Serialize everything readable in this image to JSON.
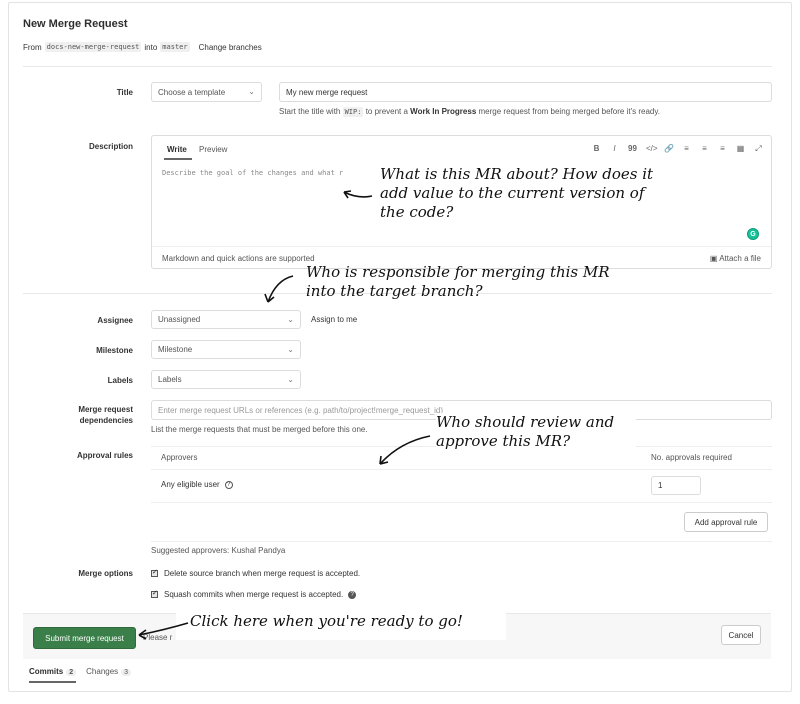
{
  "header": {
    "title": "New Merge Request",
    "from_label": "From",
    "source_branch": "docs-new-merge-request",
    "into_label": "into",
    "target_branch": "master",
    "change_branches": "Change branches"
  },
  "title_field": {
    "label": "Title",
    "template_dropdown": "Choose a template",
    "value": "My new merge request",
    "help_prefix": "Start the title with",
    "help_code": "WIP:",
    "help_middle": "to prevent a",
    "help_bold": "Work In Progress",
    "help_suffix": "merge request from being merged before it's ready."
  },
  "description": {
    "label": "Description",
    "tab_write": "Write",
    "tab_preview": "Preview",
    "toolbar": [
      "B",
      "I",
      "99",
      "</>",
      "🔗",
      "≡",
      "≡",
      "≡",
      "▦",
      "⤢"
    ],
    "placeholder": "Describe the goal of the changes and what r",
    "footer_left": "Markdown and quick actions are supported",
    "footer_right": "Attach a file",
    "grammarly": "G"
  },
  "assignee": {
    "label": "Assignee",
    "value": "Unassigned",
    "assign_to_me": "Assign to me"
  },
  "milestone": {
    "label": "Milestone",
    "value": "Milestone"
  },
  "labels": {
    "label": "Labels",
    "value": "Labels"
  },
  "dependencies": {
    "label_line1": "Merge request",
    "label_line2": "dependencies",
    "placeholder": "Enter merge request URLs or references (e.g. path/to/project!merge_request_id)",
    "help": "List the merge requests that must be merged before this one."
  },
  "approval_rules": {
    "label": "Approval rules",
    "col_approvers": "Approvers",
    "col_required": "No. approvals required",
    "row_name": "Any eligible user",
    "row_value": "1",
    "add_button": "Add approval rule",
    "suggested": "Suggested approvers: Kushal Pandya"
  },
  "merge_options": {
    "label": "Merge options",
    "delete_source": "Delete source branch when merge request is accepted.",
    "squash": "Squash commits when merge request is accepted."
  },
  "actions": {
    "submit": "Submit merge request",
    "please_note": "Please r",
    "cancel": "Cancel"
  },
  "bottom_tabs": [
    {
      "label": "Commits",
      "count": "2"
    },
    {
      "label": "Changes",
      "count": "3"
    }
  ],
  "annotations": {
    "description_note": "What is this MR about? How does it add value to the current version of the code?",
    "assignee_note": "Who is responsible for merging this MR into the target branch?",
    "approval_note": "Who should review and approve this MR?",
    "submit_note": "Click here when you're ready to go!"
  },
  "colors": {
    "submit_green": "#3a7f49",
    "grammarly_green": "#15c39a"
  }
}
